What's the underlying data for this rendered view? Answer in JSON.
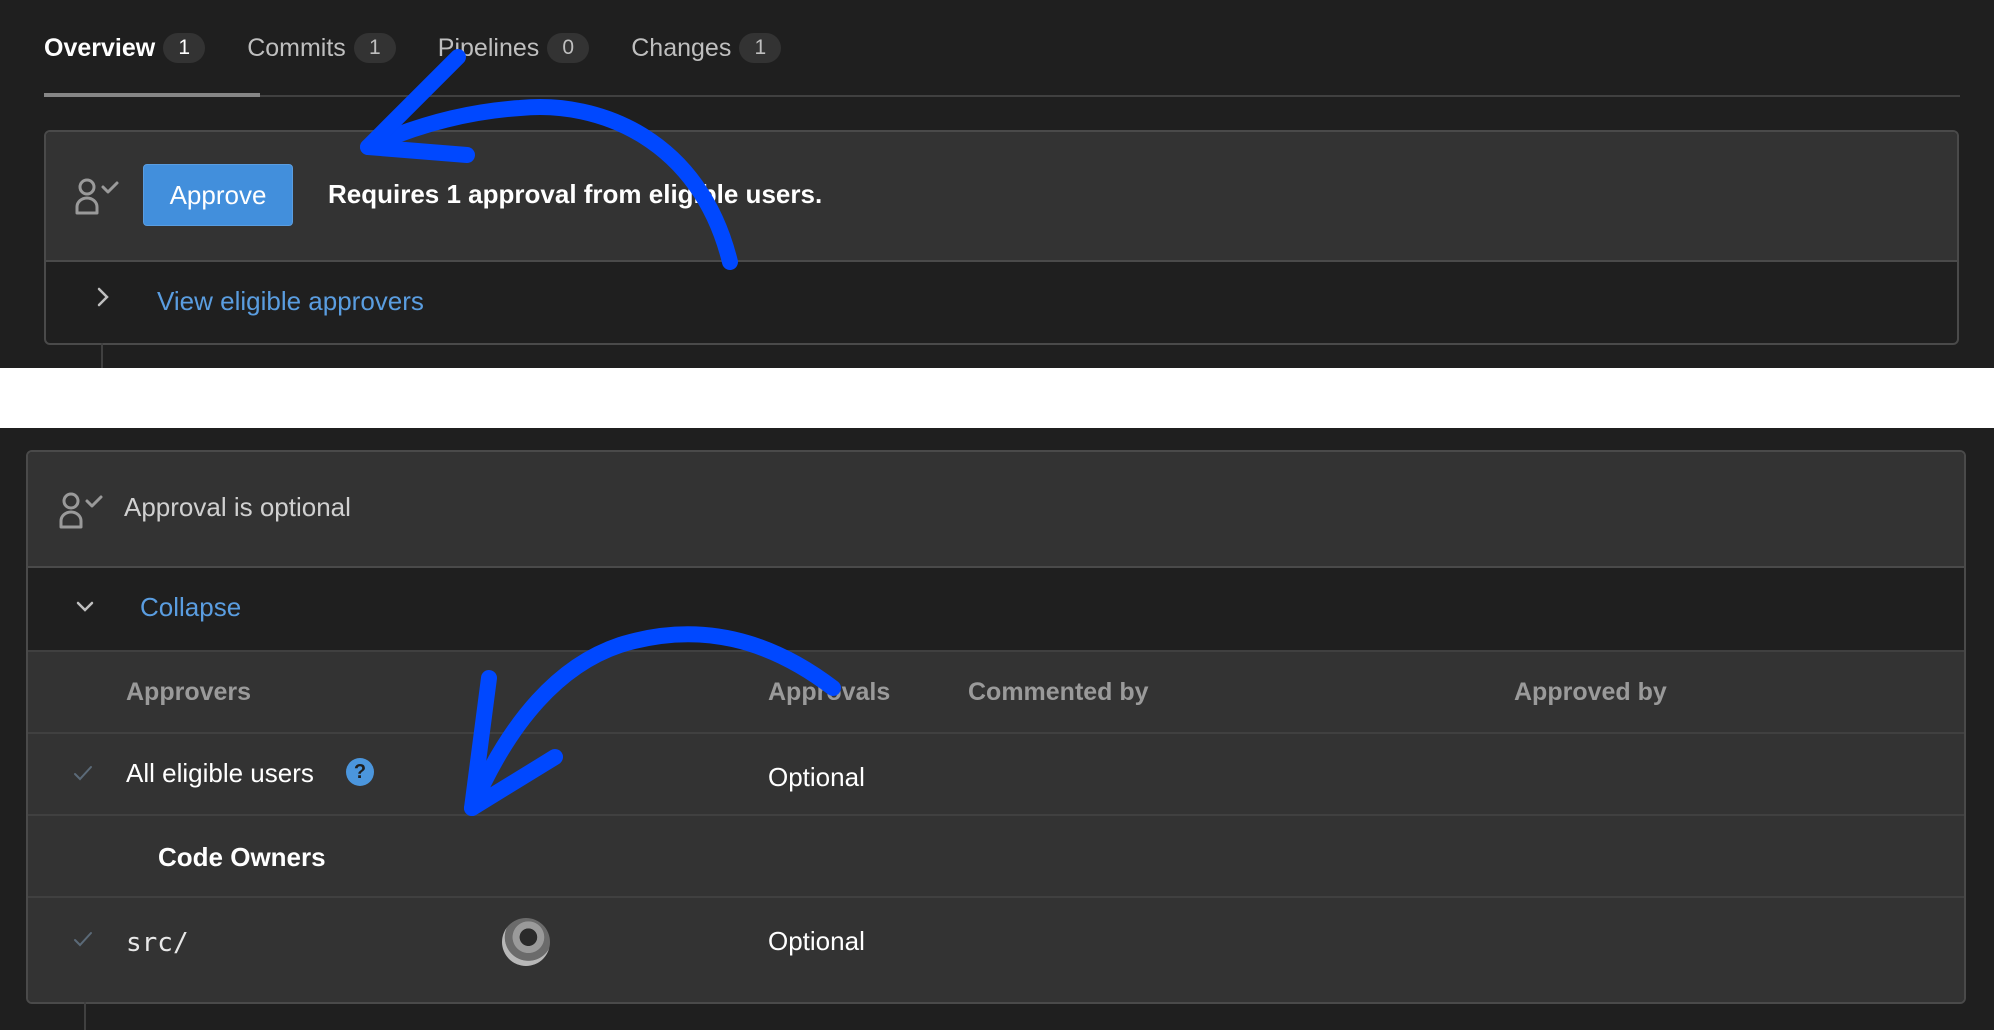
{
  "top": {
    "tabs": [
      {
        "label": "Overview",
        "count": "1",
        "active": true
      },
      {
        "label": "Commits",
        "count": "1",
        "active": false
      },
      {
        "label": "Pipelines",
        "count": "0",
        "active": false
      },
      {
        "label": "Changes",
        "count": "1",
        "active": false
      }
    ],
    "approval_panel": {
      "icon": "approval-user-check-icon",
      "approve_button": "Approve",
      "status_text": "Requires 1 approval from eligible users.",
      "toggle_icon": "chevron-right-icon",
      "toggle_link": "View eligible approvers"
    }
  },
  "bottom": {
    "approval_panel": {
      "icon": "approval-user-check-icon",
      "status_text": "Approval is optional",
      "toggle_icon": "chevron-down-icon",
      "toggle_link": "Collapse"
    },
    "table": {
      "headers": [
        "Approvers",
        "Approvals",
        "Commented by",
        "Approved by"
      ],
      "rows": [
        {
          "type": "rule",
          "approver": "All eligible users",
          "help_icon": "question-icon",
          "approvals": "Optional",
          "commented_by": "",
          "approved_by": ""
        },
        {
          "type": "group",
          "label": "Code Owners"
        },
        {
          "type": "rule",
          "approver": "src/",
          "avatar": "user-avatar",
          "approvals": "Optional",
          "commented_by": "",
          "approved_by": ""
        }
      ]
    }
  },
  "annotations": {
    "arrow_color": "#0048ff",
    "arrows": [
      {
        "name": "arrow-to-approve-button",
        "points_to": "Approve button"
      },
      {
        "name": "arrow-to-all-eligible-users",
        "points_to": "All eligible users"
      }
    ]
  },
  "colors": {
    "background": "#1f1f1f",
    "panel_header": "#333333",
    "border": "#4a4a4a",
    "primary_button": "#428fdc",
    "link": "#5a9de0"
  }
}
